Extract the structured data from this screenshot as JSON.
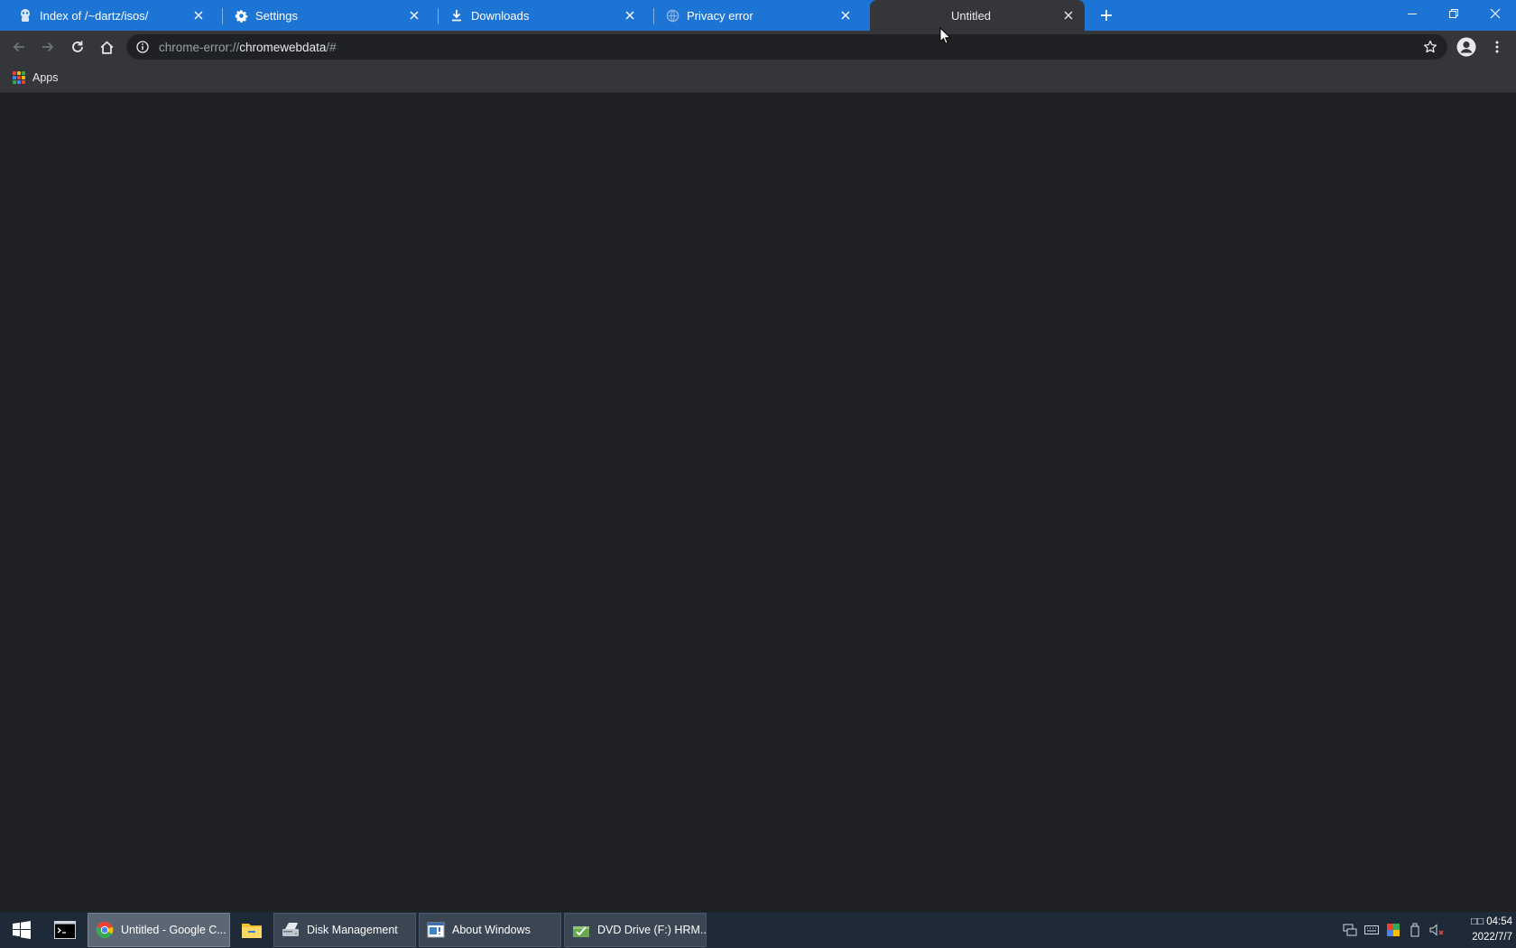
{
  "browser": {
    "tabs": [
      {
        "title": "Index of /~dartz/isos/",
        "icon": "dartz-favicon-icon",
        "active": false
      },
      {
        "title": "Settings",
        "icon": "gear-icon",
        "active": false
      },
      {
        "title": "Downloads",
        "icon": "download-icon",
        "active": false
      },
      {
        "title": "Privacy error",
        "icon": "globe-icon",
        "active": false
      },
      {
        "title": "Untitled",
        "icon": "none",
        "active": true
      }
    ],
    "address": {
      "scheme": "chrome-error://",
      "host": "chromewebdata",
      "path": "/#"
    },
    "bookmarks": [
      {
        "label": "Apps",
        "icon": "apps-grid-icon"
      }
    ],
    "colors": {
      "tabstrip": "#1c74d4",
      "toolbar": "#35363a",
      "page": "#202124"
    }
  },
  "taskbar": {
    "tasks": [
      {
        "label": "Untitled - Google C...",
        "icon": "chrome-icon",
        "active": true
      },
      {
        "label": "Disk Management",
        "icon": "disk-management-icon",
        "active": false
      },
      {
        "label": "About Windows",
        "icon": "about-windows-icon",
        "active": false
      },
      {
        "label": "DVD Drive (F:) HRM...",
        "icon": "dvd-drive-icon",
        "active": false
      }
    ],
    "clock": {
      "time": "□□ 04:54",
      "date": "2022/7/7"
    }
  }
}
